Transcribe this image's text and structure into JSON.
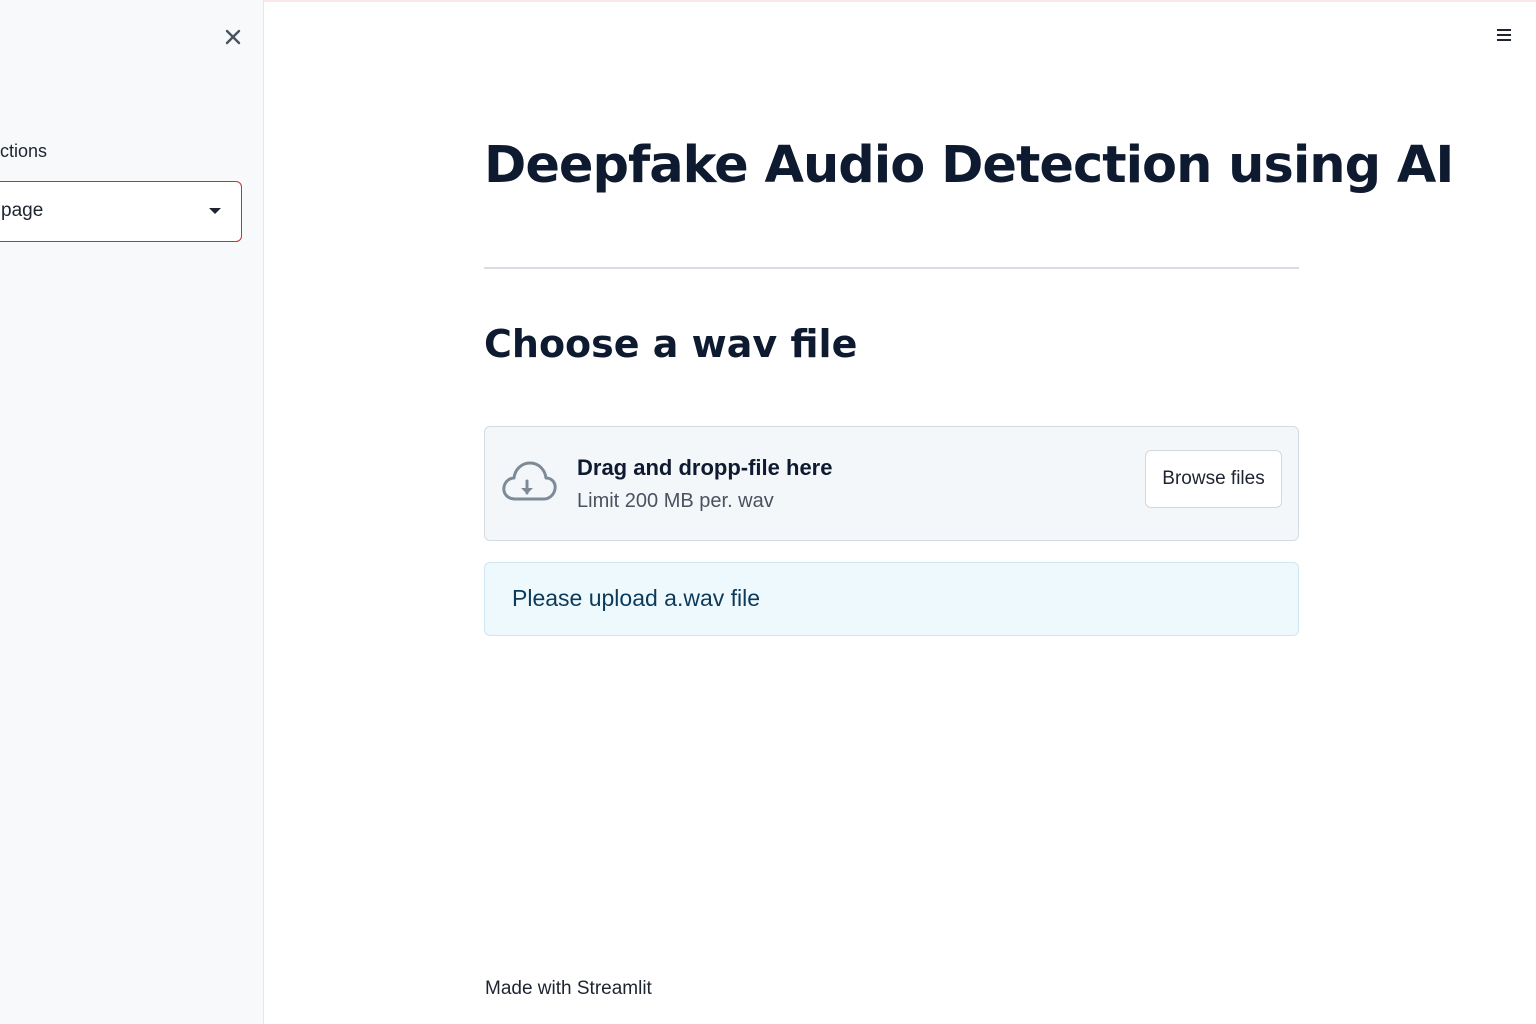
{
  "sidebar": {
    "label": "ctions",
    "select_value": "page",
    "close_symbol": "×"
  },
  "main": {
    "title": "Deepfake Audio Detection using AI",
    "section_title": "Choose a wav file",
    "uploader": {
      "title": "Drag and dropp-file here",
      "limit": "Limit 200 MB per. wav",
      "browse_label": "Browse files",
      "icon": "cloud-download-icon"
    },
    "info_message": "Please upload a.wav file"
  },
  "footer": {
    "text": "Made with Streamlit"
  },
  "colors": {
    "accent_border": "#c8302f",
    "info_bg": "#eef9fd",
    "sidebar_bg": "#f8f9fb"
  }
}
